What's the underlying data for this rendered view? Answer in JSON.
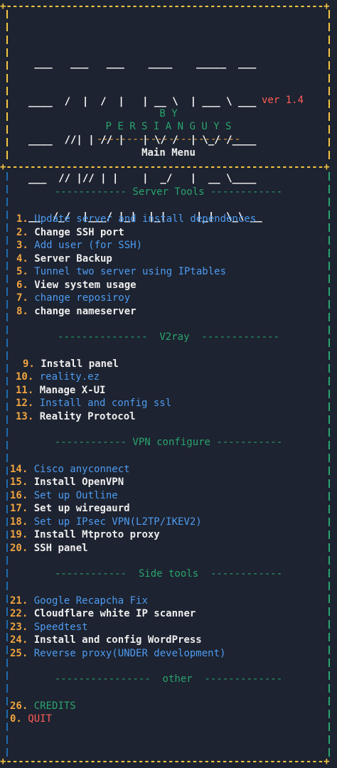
{
  "title_logo_lines": [
    " ___   ___   ___    ____    _____  ___",
    "____  /  |  /  |   | __ \\  | ___ \\ ___",
    "____  //| | // |   | \\/ /  | \\_/ /____",
    "___  // |// | |    |  _/   |  __ \\____",
    "__  /_/  |___/ |_|  |_|     |_|  \\_\\ __"
  ],
  "version": "ver 1.4",
  "by": "B Y",
  "author": "P E R S I A N G U Y S",
  "divider": "------------------------",
  "main_menu": "Main Menu",
  "sections": [
    {
      "title": "------------ Server Tools ------------",
      "items": [
        {
          "num": "1.",
          "label": "Update server and install dependences",
          "color": "#4e9bf1"
        },
        {
          "num": "2.",
          "label": "Change SSH port",
          "color": "#eeeeee"
        },
        {
          "num": "3.",
          "label": "Add user (for SSH)",
          "color": "#4e9bf1"
        },
        {
          "num": "4.",
          "label": "Server Backup",
          "color": "#eeeeee"
        },
        {
          "num": "5.",
          "label": "Tunnel two server using IPtables",
          "color": "#4e9bf1"
        },
        {
          "num": "6.",
          "label": "View system usage",
          "color": "#eeeeee"
        },
        {
          "num": "7.",
          "label": "change reposiroy",
          "color": "#4e9bf1"
        },
        {
          "num": "8.",
          "label": "change nameserver",
          "color": "#eeeeee"
        }
      ]
    },
    {
      "title": "---------------  V2ray  -------------",
      "items": [
        {
          "num": "9.",
          "label": "Install panel",
          "color": "#eeeeee"
        },
        {
          "num": "10.",
          "label": "reality.ez",
          "color": "#4e9bf1"
        },
        {
          "num": "11.",
          "label": "Manage X-UI",
          "color": "#eeeeee"
        },
        {
          "num": "12.",
          "label": "Install and config ssl",
          "color": "#4e9bf1"
        },
        {
          "num": "13.",
          "label": "Reality Protocol",
          "color": "#eeeeee"
        }
      ]
    },
    {
      "title": "------------ VPN configure -----------",
      "items": [
        {
          "num": "14.",
          "label": "Cisco anyconnect",
          "color": "#4e9bf1"
        },
        {
          "num": "15.",
          "label": "Install OpenVPN",
          "color": "#eeeeee"
        },
        {
          "num": "16.",
          "label": "Set up Outline",
          "color": "#4e9bf1"
        },
        {
          "num": "17.",
          "label": "Set up wiregaurd",
          "color": "#eeeeee"
        },
        {
          "num": "18.",
          "label": "Set up IPsec VPN(L2TP/IKEV2)",
          "color": "#4e9bf1"
        },
        {
          "num": "19.",
          "label": "Install Mtproto proxy",
          "color": "#eeeeee"
        },
        {
          "num": "20.",
          "label": "SSH panel",
          "color": "#eeeeee"
        }
      ]
    },
    {
      "title": "------------  Side tools  ------------",
      "items": [
        {
          "num": "21.",
          "label": "Google Recapcha Fix",
          "color": "#4e9bf1"
        },
        {
          "num": "22.",
          "label": "Cloudflare white IP scanner",
          "color": "#eeeeee"
        },
        {
          "num": "23.",
          "label": "Speedtest",
          "color": "#4e9bf1"
        },
        {
          "num": "24.",
          "label": "Install and config WordPress",
          "color": "#eeeeee"
        },
        {
          "num": "25.",
          "label": "Reverse proxy(UNDER development)",
          "color": "#4e9bf1"
        }
      ]
    },
    {
      "title": "----------------  other  -------------",
      "items": [
        {
          "num": "26.",
          "label": "CREDITS",
          "color": "#2aa36e"
        },
        {
          "num": "0.",
          "label": "QUIT",
          "color": "#ff5c57"
        }
      ]
    }
  ],
  "colors": {
    "background": "#1d2330",
    "border": "#f5c542",
    "number": "#f2a541",
    "section": "#2aa36e"
  }
}
